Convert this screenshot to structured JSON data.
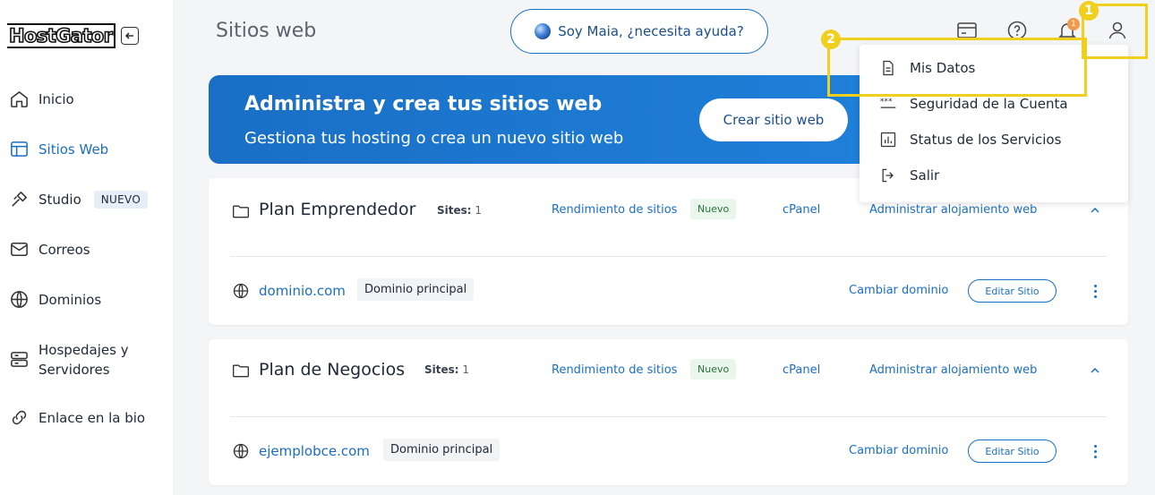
{
  "sidebar": {
    "logo": "HostGator",
    "items": [
      {
        "label": "Inicio",
        "icon": "home-icon"
      },
      {
        "label": "Sitios Web",
        "icon": "layout-icon",
        "active": true
      },
      {
        "label": "Studio",
        "icon": "studio-icon",
        "badge": "NUEVO"
      },
      {
        "label": "Correos",
        "icon": "mail-icon"
      },
      {
        "label": "Dominios",
        "icon": "globe-icon"
      },
      {
        "label": "Hospedajes y",
        "label2": "Servidores",
        "icon": "server-icon"
      },
      {
        "label": "Enlace en la bio",
        "icon": "link-icon"
      }
    ]
  },
  "header": {
    "title": "Sitios web",
    "maia_label": "Soy Maia, ¿necesita ayuda?",
    "notification_count": "1"
  },
  "banner": {
    "title": "Administra y crea tus sitios web",
    "subtitle": "Gestiona tus hosting o crea un nuevo sitio web",
    "button": "Crear sitio web"
  },
  "plans": [
    {
      "name": "Plan Emprendedor",
      "sites_label": "Sites:",
      "sites_count": "1",
      "performance_link": "Rendimiento de sitios",
      "new_badge": "Nuevo",
      "cpanel": "cPanel",
      "manage": "Administrar alojamiento web",
      "domain": "dominio.com",
      "domain_badge": "Dominio principal",
      "change_domain": "Cambiar dominio",
      "edit_site": "Editar Sitio"
    },
    {
      "name": "Plan de Negocios",
      "sites_label": "Sites:",
      "sites_count": "1",
      "performance_link": "Rendimiento de sitios",
      "new_badge": "Nuevo",
      "cpanel": "cPanel",
      "manage": "Administrar alojamiento web",
      "domain": "ejemplobce.com",
      "domain_badge": "Dominio principal",
      "change_domain": "Cambiar dominio",
      "edit_site": "Editar Sitio"
    }
  ],
  "user_menu": {
    "items": [
      {
        "label": "Mis Datos",
        "icon": "document-icon"
      },
      {
        "label": "Seguridad de la Cuenta",
        "icon": "password-icon"
      },
      {
        "label": "Status de los Servicios",
        "icon": "chart-icon"
      },
      {
        "label": "Salir",
        "icon": "logout-icon"
      }
    ]
  },
  "annotations": [
    {
      "number": "1"
    },
    {
      "number": "2"
    }
  ],
  "colors": {
    "accent": "#1a6fc4",
    "highlight": "#f0cf1f",
    "notification": "#f2994a"
  }
}
